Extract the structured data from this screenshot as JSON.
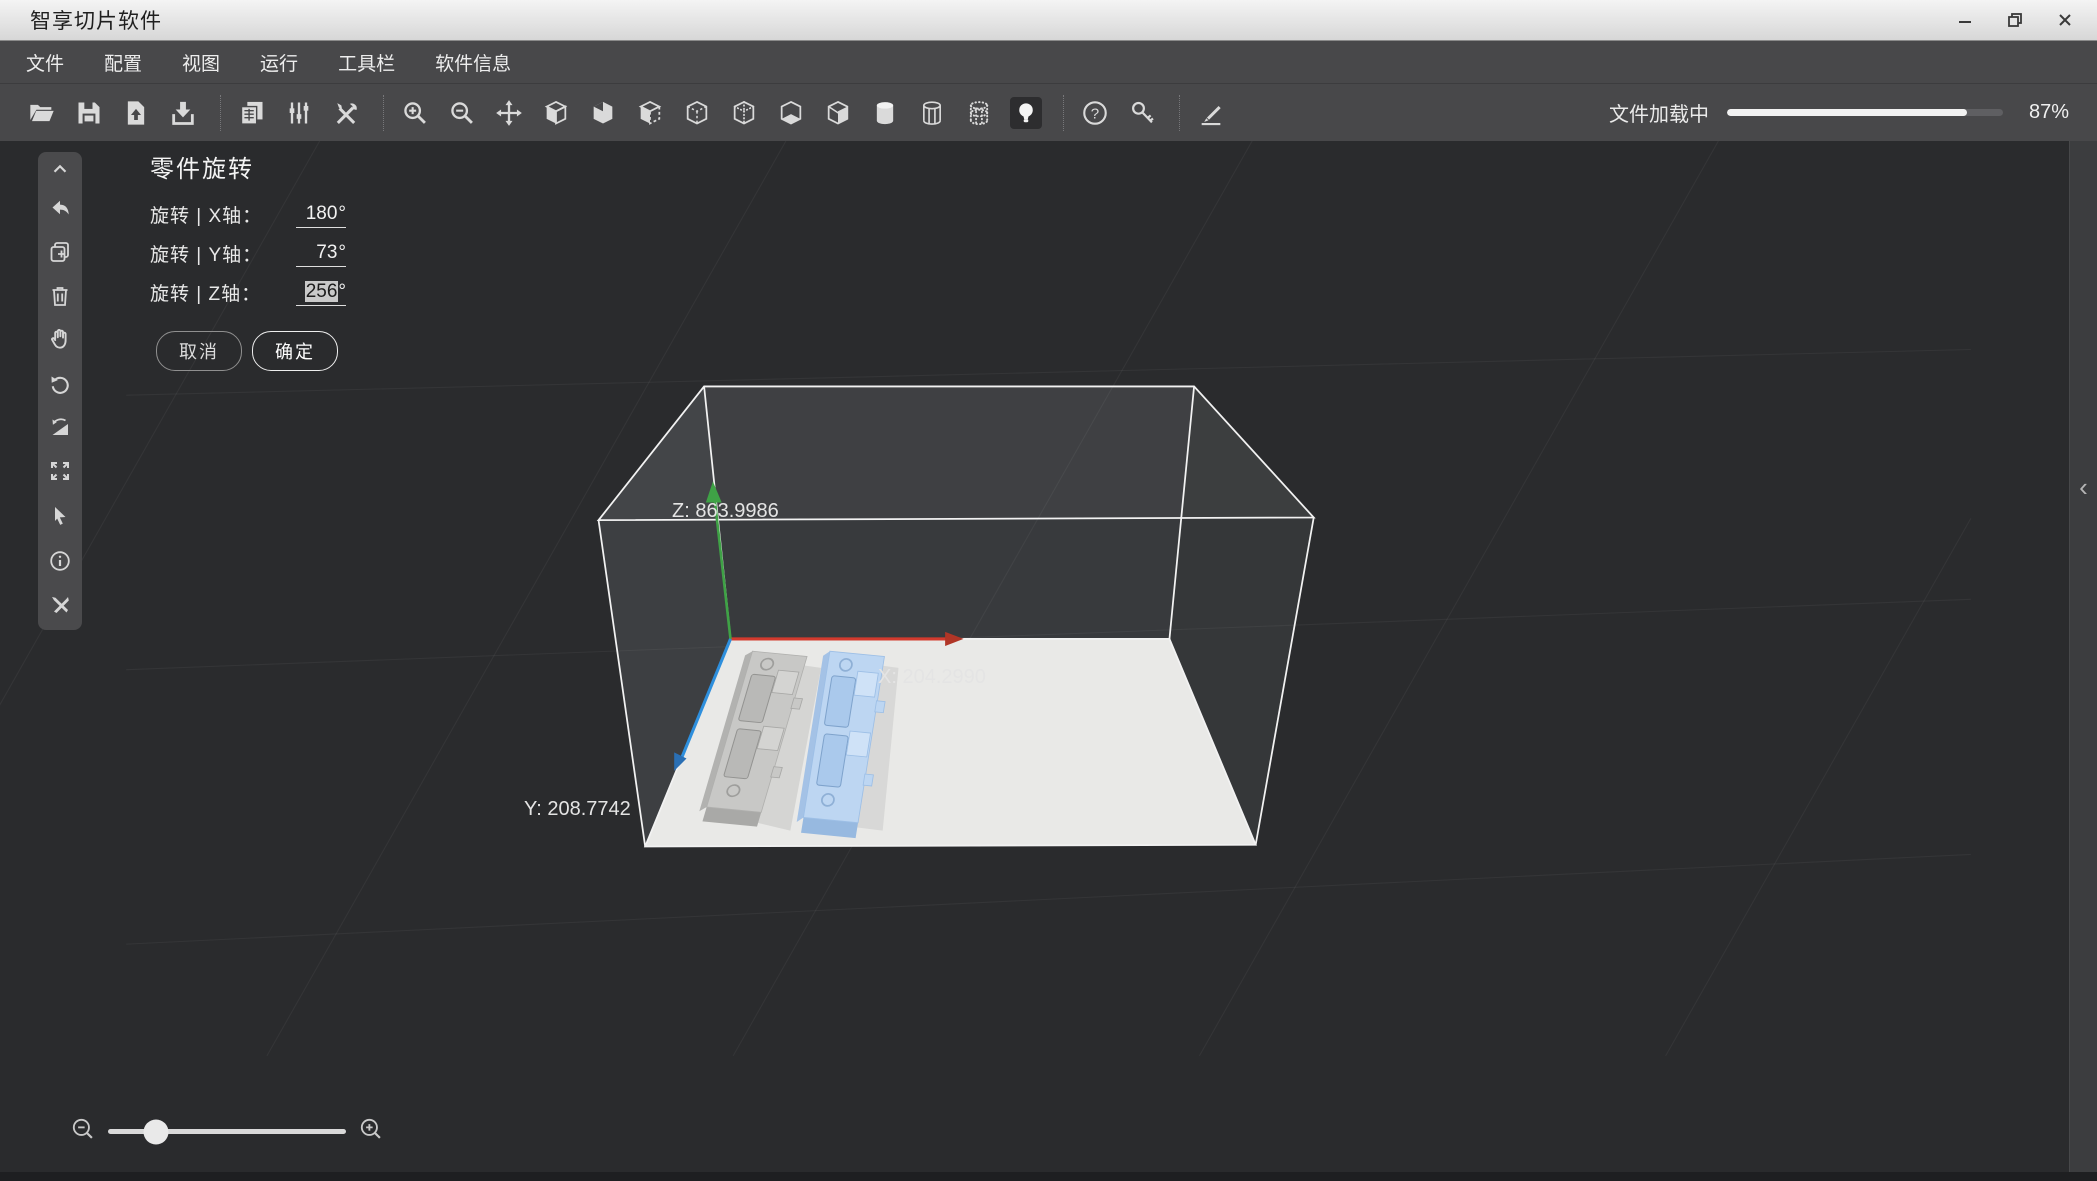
{
  "window": {
    "title": "智享切片软件",
    "controls": [
      "minimize",
      "restore",
      "close"
    ]
  },
  "menu": {
    "items": [
      "文件",
      "配置",
      "视图",
      "运行",
      "工具栏",
      "软件信息"
    ]
  },
  "toolbar": {
    "icon_names": [
      "open-file",
      "save-file",
      "import-model",
      "export-download",
      "slice-report",
      "parameter-sliders",
      "tools-settings",
      "zoom-in",
      "zoom-out",
      "move-model",
      "view-cube-solid",
      "view-cube-corner",
      "view-open-box",
      "view-dashed-box",
      "view-dotted-box",
      "view-open-bottom",
      "view-half-shaded",
      "cylinder-solid",
      "cylinder-wireframe",
      "cylinder-points",
      "light-toggle",
      "help",
      "license-key",
      "annotate-pen"
    ],
    "active_icon": "light-toggle"
  },
  "loading": {
    "label": "文件加载中",
    "percent": 87,
    "percent_label": "87%"
  },
  "rotation_panel": {
    "title": "零件旋转",
    "rows": [
      {
        "label": "旋转 | X轴：",
        "value": "180",
        "unit": "°",
        "selected": false
      },
      {
        "label": "旋转 | Y轴：",
        "value": "73",
        "unit": "°",
        "selected": false
      },
      {
        "label": "旋转 | Z轴：",
        "value": "256",
        "unit": "°",
        "selected": true
      }
    ],
    "cancel_label": "取消",
    "confirm_label": "确定"
  },
  "side_toolbar": {
    "icon_names": [
      "collapse-up",
      "undo",
      "duplicate-add",
      "delete-trash",
      "pan-hand",
      "rotate-view",
      "mirror-flip",
      "fit-expand",
      "select-cursor",
      "info",
      "repair-tools"
    ]
  },
  "viewport": {
    "axis_labels": {
      "x": "X: 204.2990",
      "y": "Y: 208.7742",
      "z": "Z: 863.9986"
    },
    "axis_colors": {
      "x": "#d23a2e",
      "y": "#2e8fdd",
      "z": "#3fa246"
    },
    "build_plate_color": "#e9e9e7",
    "models": [
      {
        "name": "model-gray",
        "color": "#c8c8c6",
        "selected": false
      },
      {
        "name": "model-blue",
        "color": "#bdd6f2",
        "selected": true
      }
    ]
  },
  "zoom_control": {
    "thumb_percent": 20
  },
  "right_panel_toggle": {
    "chevron": "‹"
  }
}
